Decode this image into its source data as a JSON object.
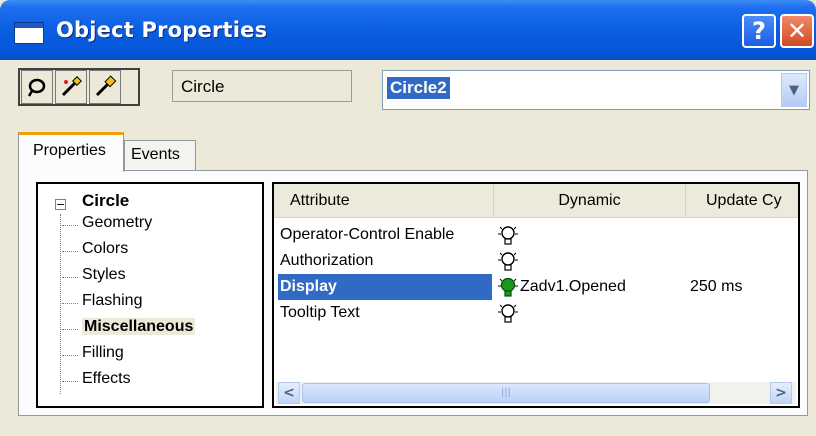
{
  "window": {
    "title": "Object Properties",
    "help_button": "?",
    "close_button": "✕"
  },
  "toolbar": {
    "object_type": "Circle",
    "object_name": "Circle2"
  },
  "tabs": [
    {
      "label": "Properties",
      "active": true
    },
    {
      "label": "Events",
      "active": false
    }
  ],
  "tree": {
    "root": "Circle",
    "items": [
      "Geometry",
      "Colors",
      "Styles",
      "Flashing",
      "Miscellaneous",
      "Filling",
      "Effects"
    ],
    "selected": "Miscellaneous"
  },
  "grid": {
    "columns": [
      "Attribute",
      "Dynamic",
      "Update Cy"
    ],
    "rows": [
      {
        "attribute": "Operator-Control Enable",
        "dynamic": "",
        "update": "",
        "active": false
      },
      {
        "attribute": "Authorization",
        "dynamic": "",
        "update": "",
        "active": false
      },
      {
        "attribute": "Display",
        "dynamic": "Zadv1.Opened",
        "update": "250 ms",
        "active": true
      },
      {
        "attribute": "Tooltip Text",
        "dynamic": "",
        "update": "",
        "active": false
      }
    ],
    "selected_row": "Display"
  },
  "colors": {
    "titlebar": "#0a5ee0",
    "selection": "#316ac5",
    "active_bulb": "#1a9a1a"
  }
}
